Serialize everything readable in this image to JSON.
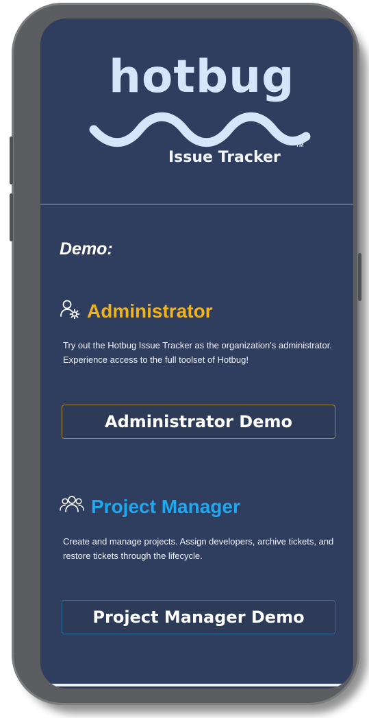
{
  "brand": {
    "logo_word": "hotbug",
    "tm": "TM",
    "subtitle": "Issue Tracker"
  },
  "demo": {
    "heading": "Demo:"
  },
  "roles": [
    {
      "title": "Administrator",
      "icon": "user-gear-icon",
      "color": "#f0b31c",
      "description": "Try out the Hotbug Issue Tracker as the organization's administrator. Experience access to the full toolset of Hotbug!",
      "button_label": "Administrator Demo",
      "button_border": "#a88a3a"
    },
    {
      "title": "Project Manager",
      "icon": "user-group-icon",
      "color": "#1ea8f0",
      "description": "Create and manage projects. Assign developers, archive tickets, and restore tickets through the lifecycle.",
      "button_label": "Project Manager Demo",
      "button_border": "#2b6f9c"
    }
  ]
}
